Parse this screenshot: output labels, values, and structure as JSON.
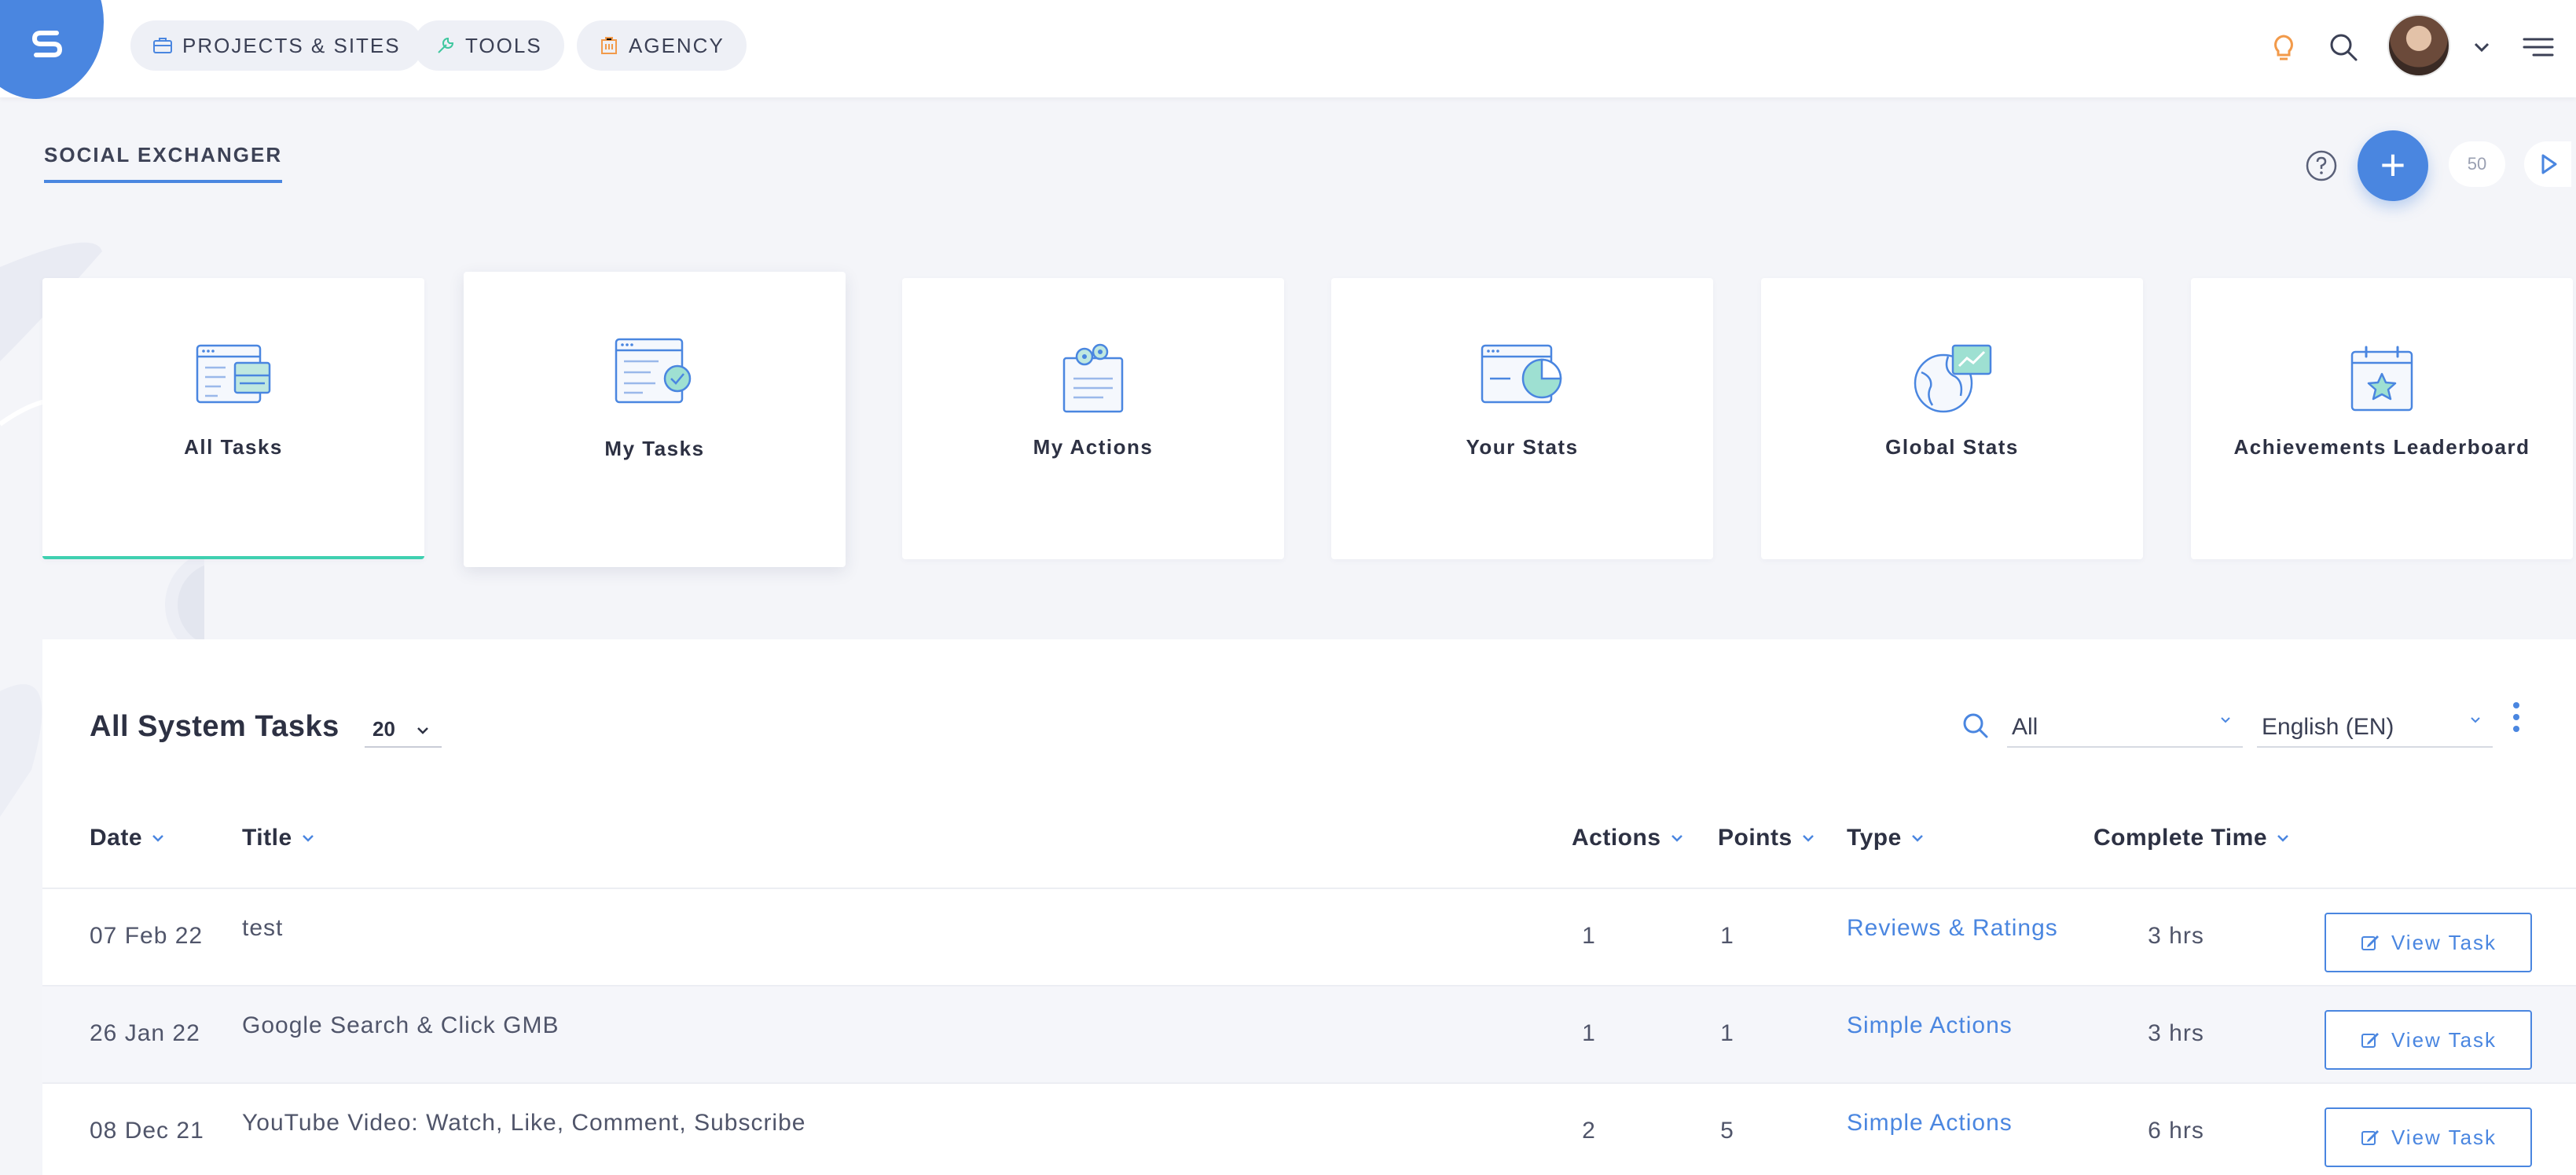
{
  "topbar": {
    "logo_letter": "S",
    "nav": [
      {
        "label": "PROJECTS & SITES",
        "icon": "briefcase-icon"
      },
      {
        "label": "TOOLS",
        "icon": "wrench-icon"
      },
      {
        "label": "AGENCY",
        "icon": "building-icon"
      }
    ]
  },
  "header": {
    "page_title": "SOCIAL EXCHANGER",
    "counter": "50"
  },
  "cards": [
    {
      "label": "All Tasks",
      "icon": "all-tasks-icon"
    },
    {
      "label": "My Tasks",
      "icon": "my-tasks-icon"
    },
    {
      "label": "My Actions",
      "icon": "my-actions-icon"
    },
    {
      "label": "Your Stats",
      "icon": "your-stats-icon"
    },
    {
      "label": "Global Stats",
      "icon": "global-stats-icon"
    },
    {
      "label": "Achievements Leaderboard",
      "icon": "leaderboard-icon"
    }
  ],
  "tasks": {
    "title": "All System Tasks",
    "per_page": "20",
    "filter_type": "All",
    "filter_language": "English (EN)",
    "columns": {
      "date": "Date",
      "title": "Title",
      "actions": "Actions",
      "points": "Points",
      "type": "Type",
      "complete_time": "Complete Time"
    },
    "view_label": "View Task",
    "rows": [
      {
        "date": "07 Feb 22",
        "title": "test",
        "actions": "1",
        "points": "1",
        "type": "Reviews & Ratings",
        "time": "3 hrs"
      },
      {
        "date": "26 Jan 22",
        "title": "Google Search & Click GMB",
        "actions": "1",
        "points": "1",
        "type": "Simple Actions",
        "time": "3 hrs"
      },
      {
        "date": "08 Dec 21",
        "title": "YouTube Video: Watch, Like, Comment, Subscribe",
        "actions": "2",
        "points": "5",
        "type": "Simple Actions",
        "time": "6 hrs"
      }
    ]
  },
  "colors": {
    "accent": "#4a86e0",
    "active_underline": "#3fd0b0",
    "page_bg": "#f4f5f9"
  }
}
